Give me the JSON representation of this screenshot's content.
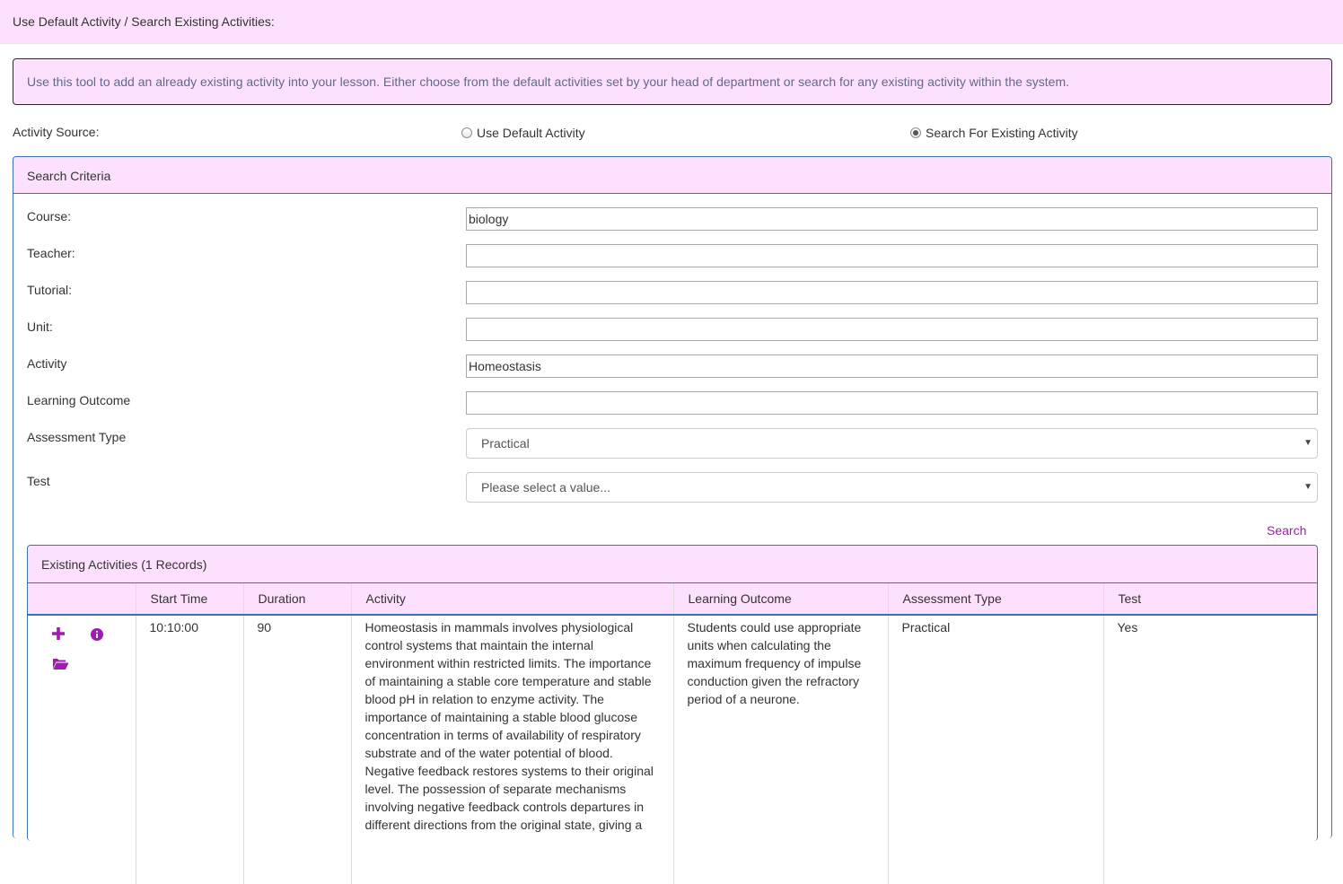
{
  "header": {
    "title": "Use Default Activity / Search Existing Activities:"
  },
  "info": {
    "text": "Use this tool to add an already existing activity into your lesson. Either choose from the default activities set by your head of department or search for any existing activity within the system."
  },
  "source": {
    "label": "Activity Source:",
    "option_default": "Use Default Activity",
    "option_search": "Search For Existing Activity",
    "selected": "Search For Existing Activity"
  },
  "criteria": {
    "title": "Search Criteria",
    "course_label": "Course:",
    "course_value": "biology",
    "teacher_label": "Teacher:",
    "teacher_value": "",
    "tutorial_label": "Tutorial:",
    "tutorial_value": "",
    "unit_label": "Unit:",
    "unit_value": "",
    "activity_label": "Activity",
    "activity_value": "Homeostasis",
    "outcome_label": "Learning Outcome",
    "outcome_value": "",
    "assessment_label": "Assessment Type",
    "assessment_value": "Practical",
    "test_label": "Test",
    "test_value": "Please select a value...",
    "search_label": "Search"
  },
  "results": {
    "title": "Existing Activities (1 Records)",
    "columns": [
      "",
      "Start Time",
      "Duration",
      "Activity",
      "Learning Outcome",
      "Assessment Type",
      "Test"
    ],
    "rows": [
      {
        "start_time": "10:10:00",
        "duration": "90",
        "activity": "Homeostasis in mammals involves physiological control systems that maintain the internal environment within restricted limits. The importance of maintaining a stable core temperature and stable blood pH in relation to enzyme activity. The importance of maintaining a stable blood glucose concentration in terms of availability of respiratory substrate and of the water potential of blood. Negative feedback restores systems to their original level. The possession of separate mechanisms involving negative feedback controls departures in different directions from the original state, giving a",
        "learning_outcome": "Students could use appropriate units when calculating the maximum frequency of impulse conduction given the refractory period of a neurone.",
        "assessment_type": "Practical",
        "test": "Yes"
      }
    ]
  },
  "colors": {
    "accent": "#a01cb0",
    "header_bg": "#fde0fd",
    "border": "#3c71b5"
  },
  "icons": [
    "plus-icon",
    "info-icon",
    "folder-open-icon",
    "caret-down-icon"
  ]
}
